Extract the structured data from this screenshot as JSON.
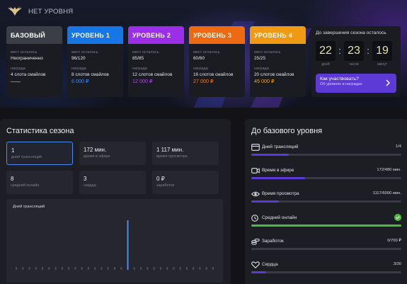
{
  "header": {
    "status_label": "НЕТ УРОВНЯ"
  },
  "levels": [
    {
      "title": "БАЗОВЫЙ",
      "seats_label": "мест осталось",
      "seats": "Неограниченно",
      "reward_label": "награда",
      "reward": "4 слота смайлов",
      "price": "—"
    },
    {
      "title": "УРОВЕНЬ 1",
      "seats_label": "мест осталось",
      "seats": "96/120",
      "reward_label": "награда",
      "reward": "8 слотов смайлов",
      "price": "6 000 ₽",
      "color": "#1676e6"
    },
    {
      "title": "УРОВЕНЬ 2",
      "seats_label": "мест осталось",
      "seats": "85/85",
      "reward_label": "награда",
      "reward": "12 слотов смайлов",
      "price": "12 000 ₽",
      "color": "#9b2ee6"
    },
    {
      "title": "УРОВЕНЬ 3",
      "seats_label": "мест осталось",
      "seats": "60/60",
      "reward_label": "награда",
      "reward": "16 слотов смайлов",
      "price": "27 000 ₽",
      "color": "#ee6a12"
    },
    {
      "title": "УРОВЕНЬ 4",
      "seats_label": "мест осталось",
      "seats": "25/25",
      "reward_label": "награда",
      "reward": "20 слотов смайлов",
      "price": "45 000 ₽",
      "color": "#f09a14"
    }
  ],
  "countdown": {
    "title": "До завершения сезона осталось",
    "days": "22",
    "days_label": "дней",
    "hours": "23",
    "hours_label": "часов",
    "minutes": "19",
    "minutes_label": "минут",
    "sep": ":",
    "cta_title": "Как участвовать?",
    "cta_subtitle": "Об уровнях и наградах"
  },
  "stats": {
    "title": "Статистика сезона",
    "tiles": [
      {
        "value": "1",
        "label": "дней трансляций"
      },
      {
        "value": "172 мин.",
        "label": "время в эфире"
      },
      {
        "value": "1 117 мин.",
        "label": "время просмотра"
      },
      {
        "value": "8",
        "label": "средний онлайн"
      },
      {
        "value": "3",
        "label": "сердца"
      },
      {
        "value": "0 ₽",
        "label": "заработок"
      }
    ]
  },
  "chart_data": {
    "type": "bar",
    "title": "Дней трансляций",
    "x": [
      1,
      2,
      3,
      4,
      5,
      6,
      7,
      8,
      9,
      10,
      11,
      12,
      13,
      14,
      15,
      16,
      17,
      18,
      19,
      20,
      21,
      22,
      23,
      24,
      25,
      26,
      27,
      28,
      29,
      30,
      31
    ],
    "values": [
      0,
      0,
      0,
      0,
      0,
      0,
      0,
      0,
      0,
      0,
      0,
      0,
      0,
      0,
      0,
      0,
      0,
      1,
      0,
      0,
      0,
      0,
      0,
      0,
      0,
      0,
      0,
      0,
      0,
      0,
      0
    ],
    "ylim": [
      0,
      1
    ],
    "color": "#4b8cf0",
    "grid": false,
    "xlabel": "",
    "ylabel": ""
  },
  "base_level": {
    "title": "До базового уровня",
    "requirements": [
      {
        "name": "Дней трансляций",
        "value": "1/4",
        "progress": 0.25,
        "icon": "calendar-icon",
        "done": false
      },
      {
        "name": "Время в эфире",
        "value": "172/480 мин.",
        "progress": 0.358,
        "icon": "broadcast-icon",
        "done": false
      },
      {
        "name": "Время просмотра",
        "value": "1117/6000 мин.",
        "progress": 0.186,
        "icon": "eye-icon",
        "done": false
      },
      {
        "name": "Средний онлайн",
        "value": "",
        "progress": 1.0,
        "icon": "clock-icon",
        "done": true
      },
      {
        "name": "Заработок",
        "value": "0/700 ₽",
        "progress": 0.0,
        "icon": "coins-icon",
        "done": false
      },
      {
        "name": "Сердца",
        "value": "3/30",
        "progress": 0.1,
        "icon": "heart-icon",
        "done": false
      }
    ]
  }
}
